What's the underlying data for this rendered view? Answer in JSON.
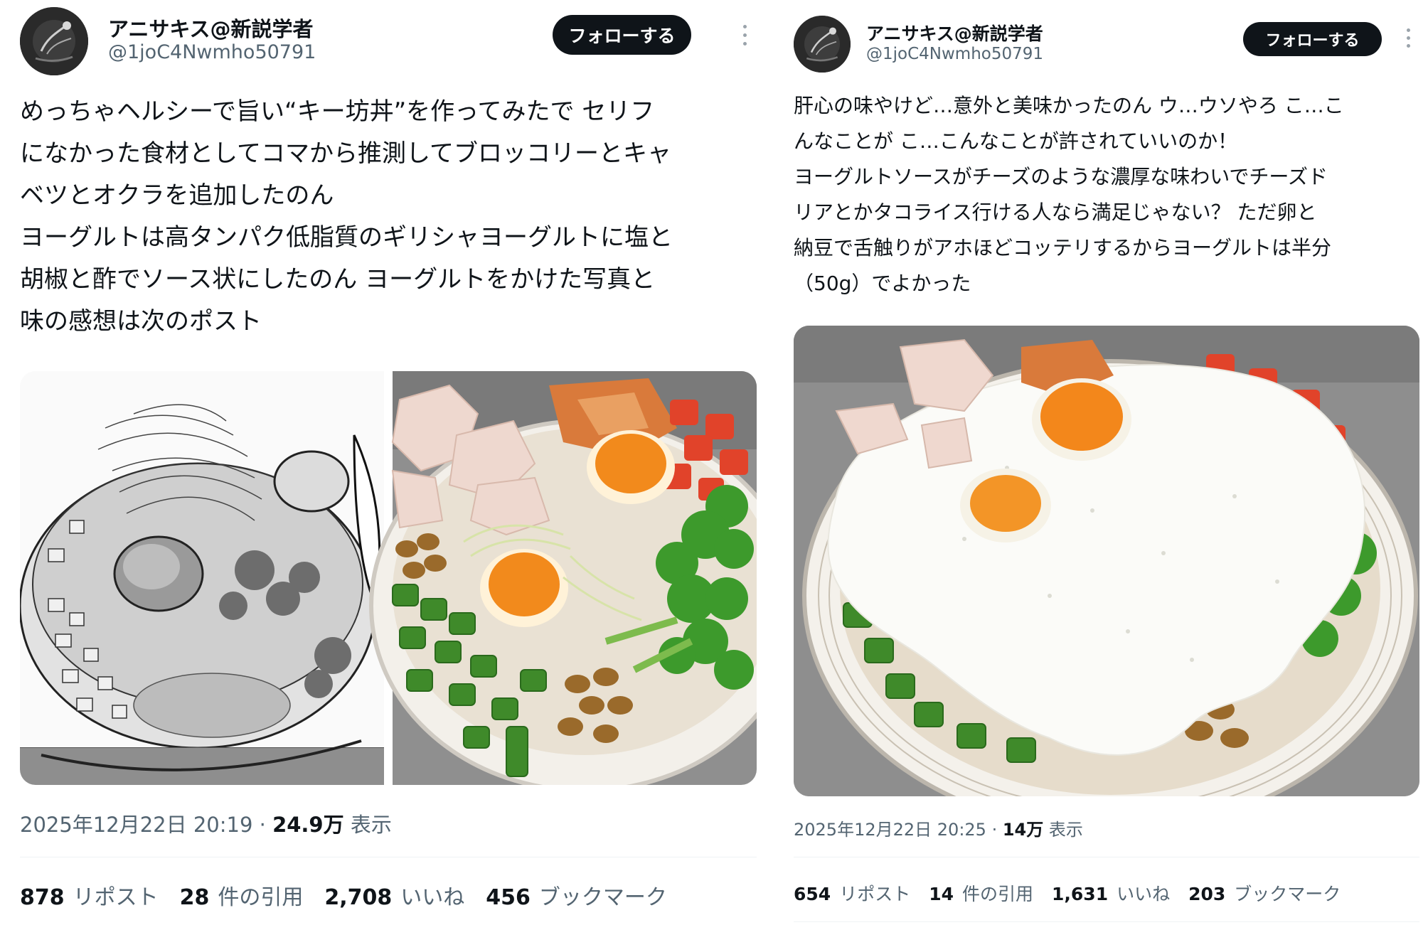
{
  "left": {
    "author": {
      "name": "アニサキス@新説学者",
      "handle": "@1joC4Nwmho50791"
    },
    "follow_label": "フォローする",
    "body_lines": [
      "めっちゃヘルシーで旨い“キー坊丼”を作ってみたで セリフ",
      "になかった食材としてコマから推測してブロッコリーとキャ",
      "ベツとオクラを追加したのん",
      "ヨーグルトは高タンパク低脂質のギリシャヨーグルトに塩と",
      "胡椒と酢でソース状にしたのん ヨーグルトをかけた写真と",
      "味の感想は次のポスト"
    ],
    "timestamp": "2025年12月22日 20:19",
    "views": "24.9万",
    "views_label": "表示",
    "stats": [
      {
        "num": "878",
        "label": "リポスト"
      },
      {
        "num": "28",
        "label": "件の引用"
      },
      {
        "num": "2,708",
        "label": "いいね"
      },
      {
        "num": "456",
        "label": "ブックマーク"
      }
    ]
  },
  "right": {
    "author": {
      "name": "アニサキス@新説学者",
      "handle": "@1joC4Nwmho50791"
    },
    "follow_label": "フォローする",
    "body_lines": [
      "肝心の味やけど…意外と美味かったのん ウ…ウソやろ こ…こ",
      "んなことが こ…こんなことが許されていいのか！",
      "ヨーグルトソースがチーズのような濃厚な味わいでチーズド",
      "リアとかタコライス行ける人なら満足じゃない？ ただ卵と",
      "納豆で舌触りがアホほどコッテリするからヨーグルトは半分",
      "（50g）でよかった"
    ],
    "timestamp": "2025年12月22日 20:25",
    "views": "14万",
    "views_label": "表示",
    "stats": [
      {
        "num": "654",
        "label": "リポスト"
      },
      {
        "num": "14",
        "label": "件の引用"
      },
      {
        "num": "1,631",
        "label": "いいね"
      },
      {
        "num": "203",
        "label": "ブックマーク"
      }
    ]
  },
  "icons": {
    "more": "more-vertical-icon",
    "avatar": "anisakis-avatar"
  },
  "colors": {
    "text": "#0f1419",
    "secondary": "#536471",
    "button": "#0f1419",
    "divider": "#eff3f4"
  }
}
